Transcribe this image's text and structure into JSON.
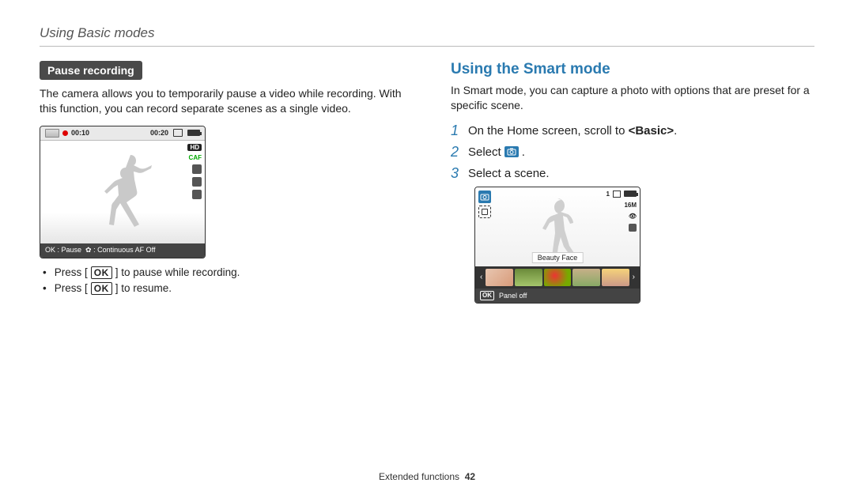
{
  "header": "Using Basic modes",
  "left": {
    "pill": "Pause recording",
    "intro": "The camera allows you to temporarily pause a video while recording. With this function, you can record separate scenes as a single video.",
    "shot": {
      "elapsed": "00:10",
      "remaining": "00:20",
      "hd": "HD",
      "caf": "CAF",
      "tip": "OK : Pause       : Continuous AF Off"
    },
    "bullet1_a": "Press [",
    "bullet1_b": "] to pause while recording.",
    "bullet2_a": "Press [",
    "bullet2_b": "] to resume.",
    "ok": "OK"
  },
  "right": {
    "title": "Using the Smart mode",
    "intro": "In Smart mode, you can capture a photo with options that are preset for a specific scene.",
    "steps": {
      "s1": {
        "num": "1",
        "a": "On the Home screen, scroll to ",
        "b": "<Basic>",
        "c": "."
      },
      "s2": {
        "num": "2",
        "a": "Select ",
        "b": " ."
      },
      "s3": {
        "num": "3",
        "a": "Select a scene."
      }
    },
    "shot": {
      "count": "1",
      "res": "16M",
      "scene": "Beauty Face",
      "bottom": "Panel off",
      "ok": "OK"
    }
  },
  "footer": {
    "section": "Extended functions",
    "page": "42"
  }
}
